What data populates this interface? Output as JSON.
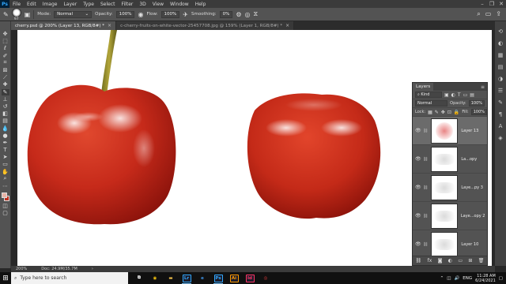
{
  "menubar": {
    "logo": "Ps",
    "items": [
      "File",
      "Edit",
      "Image",
      "Layer",
      "Type",
      "Select",
      "Filter",
      "3D",
      "View",
      "Window",
      "Help"
    ]
  },
  "options": {
    "brush_size": "97",
    "mode_label": "Mode:",
    "mode_value": "Normal",
    "opacity_label": "Opacity:",
    "opacity_value": "100%",
    "flow_label": "Flow:",
    "flow_value": "100%",
    "smoothing_label": "Smoothing:",
    "smoothing_value": "0%"
  },
  "tabs": [
    {
      "label": "cherry.psd @ 200% (Layer 13, RGB/8#) *",
      "active": true
    },
    {
      "label": "c-cherry-fruits-on-white-vector-25457708.jpg @ 159% (Layer 1, RGB/8#) *",
      "active": false
    }
  ],
  "status": {
    "zoom": "200%",
    "doc": "Doc: 24.9M/35.7M"
  },
  "layers_panel": {
    "title": "Layers",
    "kind_label": "Kind",
    "blend_mode": "Normal",
    "opacity_label": "Opacity:",
    "opacity_value": "100%",
    "lock_label": "Lock:",
    "fill_label": "Fill:",
    "fill_value": "100%",
    "layers": [
      {
        "name": "Layer 13",
        "active": true,
        "thumb": "blob"
      },
      {
        "name": "La...opy",
        "active": false,
        "thumb": "soft"
      },
      {
        "name": "Laye...py 3",
        "active": false,
        "thumb": "soft"
      },
      {
        "name": "Laye...opy 2",
        "active": false,
        "thumb": "soft"
      },
      {
        "name": "Layer 10",
        "active": false,
        "thumb": "soft"
      }
    ]
  },
  "taskbar": {
    "search_placeholder": "Type here to search",
    "time": "11:28 AM",
    "date": "6/24/2021",
    "lang": "ENG",
    "apps": [
      {
        "name": "task-view",
        "glyph": "⧉",
        "color": "#ffffff"
      },
      {
        "name": "chrome",
        "glyph": "◉",
        "color": "#f4c20d"
      },
      {
        "name": "file-explorer",
        "glyph": "▬",
        "color": "#f3c14b"
      },
      {
        "name": "lightroom",
        "glyph": "Lr",
        "color": "#31a8ff"
      },
      {
        "name": "edge",
        "glyph": "e",
        "color": "#3c8fe0"
      },
      {
        "name": "photoshop",
        "glyph": "Ps",
        "color": "#31a8ff"
      },
      {
        "name": "illustrator",
        "glyph": "Ai",
        "color": "#ff9a00"
      },
      {
        "name": "indesign",
        "glyph": "Id",
        "color": "#ff3366"
      },
      {
        "name": "recorder",
        "glyph": "◎",
        "color": "#e03a3a"
      }
    ]
  },
  "colors": {
    "foreground": "#e8b3a6",
    "background": "#c0301f",
    "cherry_main": "#c62a1a",
    "cherry_dark": "#8e140c"
  }
}
